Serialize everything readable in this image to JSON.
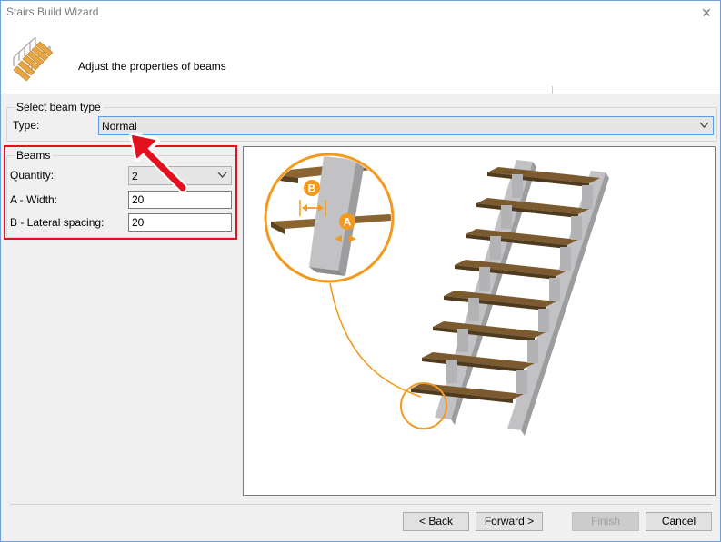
{
  "window": {
    "title": "Stairs Build Wizard",
    "close_glyph": "✕"
  },
  "header": {
    "subtitle": "Adjust the properties of beams"
  },
  "beam_type": {
    "legend": "Select beam type",
    "type_label": "Type:",
    "type_value": "Normal"
  },
  "beams": {
    "legend": "Beams",
    "quantity_label": "Quantity:",
    "quantity_value": "2",
    "width_label": "A - Width:",
    "width_value": "20",
    "spacing_label": "B - Lateral spacing:",
    "spacing_value": "20"
  },
  "preview": {
    "marker_a": "A",
    "marker_b": "B"
  },
  "buttons": {
    "back": "< Back",
    "forward": "Forward >",
    "finish": "Finish",
    "cancel": "Cancel"
  },
  "colors": {
    "highlight": "#e3101e",
    "accent": "#f39a1e",
    "tread": "#7a5a2e"
  },
  "icons": [
    "stairs-icon",
    "close-icon",
    "chevron-down-icon",
    "red-arrow-icon"
  ]
}
